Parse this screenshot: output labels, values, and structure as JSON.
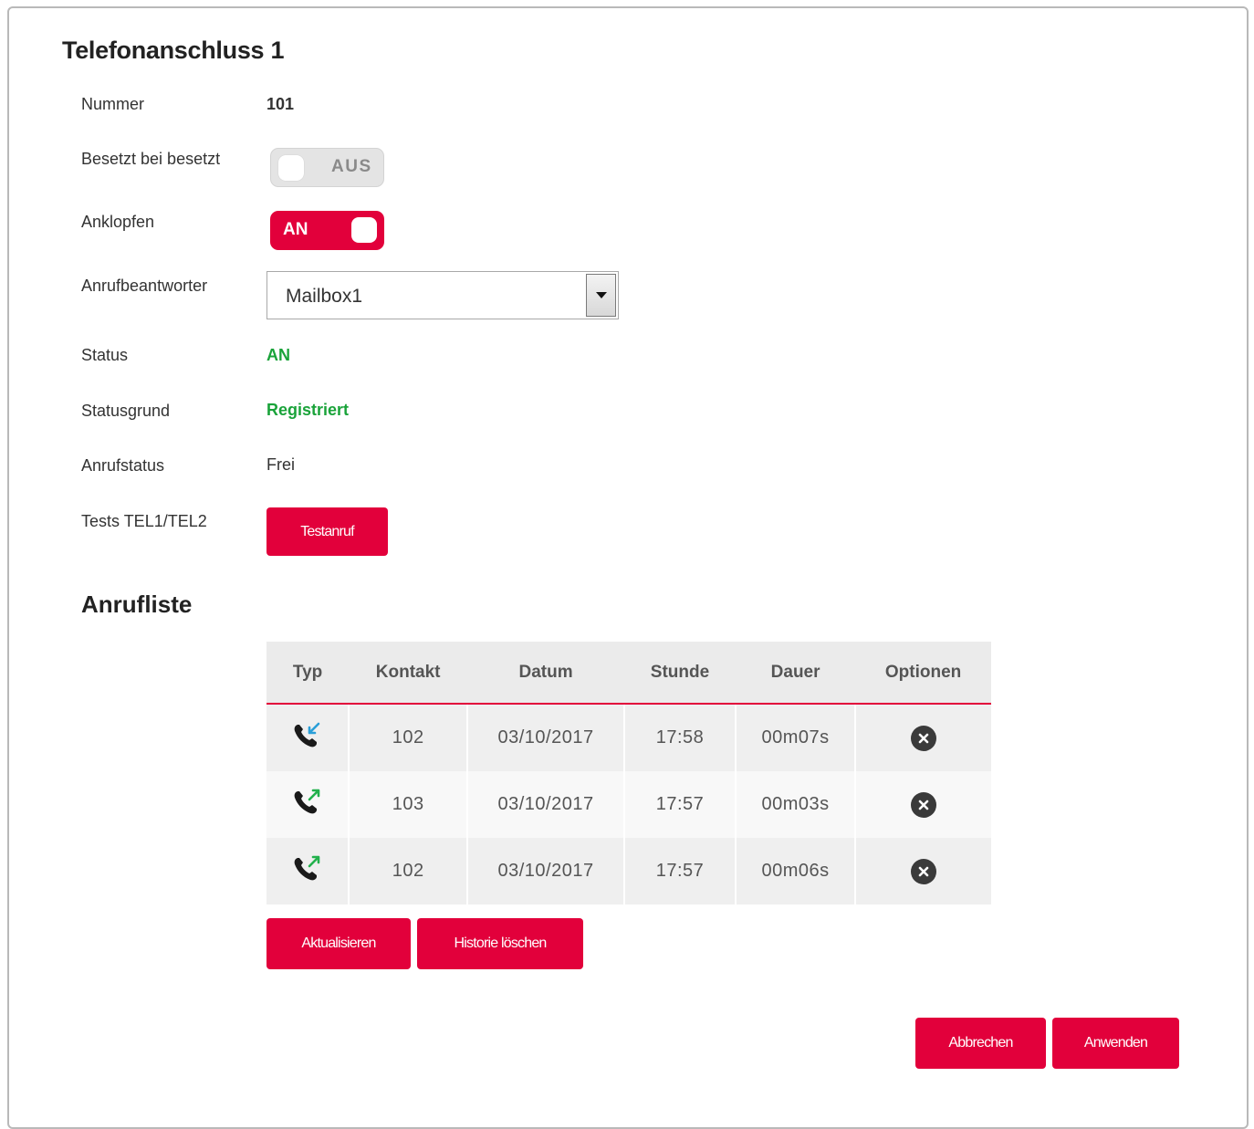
{
  "page": {
    "title": "Telefonanschluss 1"
  },
  "settings": {
    "nummer_label": "Nummer",
    "nummer_value": "101",
    "besetzt_label": "Besetzt bei besetzt",
    "besetzt_toggle": "AUS",
    "anklopfen_label": "Anklopfen",
    "anklopfen_toggle": "AN",
    "ab_label": "Anrufbeantworter",
    "ab_selected": "Mailbox1",
    "status_label": "Status",
    "status_value": "AN",
    "statusgrund_label": "Statusgrund",
    "statusgrund_value": "Registriert",
    "anrufstatus_label": "Anrufstatus",
    "anrufstatus_value": "Frei",
    "tests_label": "Tests TEL1/TEL2",
    "testanruf_button": "Testanruf"
  },
  "calllist": {
    "title": "Anrufliste",
    "headers": [
      "Typ",
      "Kontakt",
      "Datum",
      "Stunde",
      "Dauer",
      "Optionen"
    ],
    "rows": [
      {
        "type_icon": "incoming-call-icon",
        "kontakt": "102",
        "datum": "03/10/2017",
        "stunde": "17:58",
        "dauer": "00m07s"
      },
      {
        "type_icon": "outgoing-call-icon",
        "kontakt": "103",
        "datum": "03/10/2017",
        "stunde": "17:57",
        "dauer": "00m03s"
      },
      {
        "type_icon": "outgoing-call-icon",
        "kontakt": "102",
        "datum": "03/10/2017",
        "stunde": "17:57",
        "dauer": "00m06s"
      }
    ],
    "refresh_button": "Aktualisieren",
    "clear_button": "Historie löschen"
  },
  "footer": {
    "cancel_button": "Abbrechen",
    "apply_button": "Anwenden"
  },
  "colors": {
    "accent": "#e2003b",
    "status_green": "#1aa33a",
    "incoming_arrow": "#2a9fd8",
    "outgoing_arrow": "#22b14c"
  }
}
